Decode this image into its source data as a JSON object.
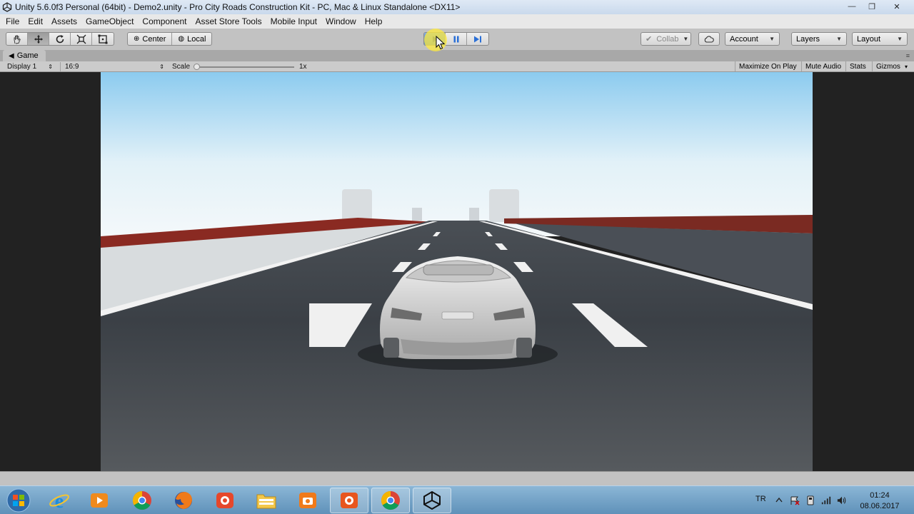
{
  "window": {
    "title": "Unity 5.6.0f3 Personal (64bit) - Demo2.unity - Pro City Roads Construction Kit - PC, Mac & Linux Standalone <DX11>",
    "controls": [
      "—",
      "❐",
      "✕"
    ]
  },
  "menu": {
    "items": [
      "File",
      "Edit",
      "Assets",
      "GameObject",
      "Component",
      "Asset Store Tools",
      "Mobile Input",
      "Window",
      "Help"
    ]
  },
  "toolbar": {
    "transform_tools": [
      "hand-tool",
      "move-tool",
      "rotate-tool",
      "scale-tool",
      "rect-tool"
    ],
    "pivot_label": "Center",
    "space_label": "Local",
    "collab_label": "Collab",
    "account_label": "Account",
    "layers_label": "Layers",
    "layout_label": "Layout"
  },
  "game_tab": {
    "label": "Game"
  },
  "game_bar": {
    "display": "Display 1",
    "aspect": "16:9",
    "scale_label": "Scale",
    "scale_value": "1x",
    "maximize": "Maximize On Play",
    "mute": "Mute Audio",
    "stats": "Stats",
    "gizmos": "Gizmos"
  },
  "taskbar": {
    "lang": "TR",
    "time": "01:24",
    "date": "08.06.2017",
    "apps": [
      "internet-explorer",
      "media-player",
      "chrome",
      "firefox",
      "screen-recorder",
      "file-explorer",
      "camera-app",
      "capture-app",
      "chrome",
      "unity"
    ]
  },
  "colors": {
    "toolbar_bg": "#c2c2c2",
    "play_blue": "#2a6fd6",
    "taskbar_top": "#8bb6d6",
    "sky_top": "#8ccbef",
    "road": "#3a3e42"
  }
}
